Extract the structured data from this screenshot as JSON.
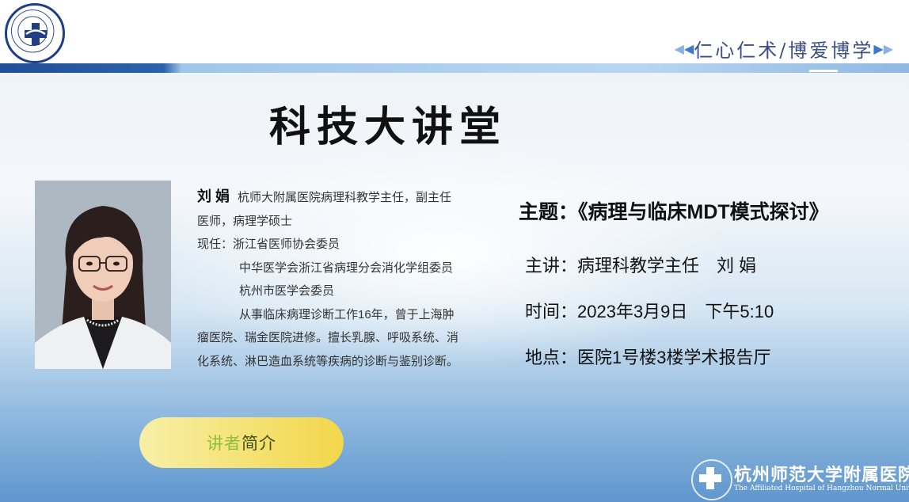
{
  "header": {
    "slogan": "仁心仁术/博爱博学"
  },
  "title": "科技大讲堂",
  "speaker": {
    "name": "刘 娟",
    "bio_lines": [
      "杭师大附属医院病理科教学主任，副主任",
      "医师，病理学硕士",
      "现任：浙江省医师协会委员",
      "中华医学会浙江省病理分会消化学组委员",
      "杭州市医学会委员",
      "从事临床病理诊断工作16年，曾于上海肿",
      "瘤医院、瑞金医院进修。擅长乳腺、呼吸系统、消",
      "化系统、淋巴造血系统等疾病的诊断与鉴别诊断。"
    ]
  },
  "event": {
    "topic": "主题：《病理与临床MDT模式探讨》",
    "lecturer": "主讲：病理科教学主任　刘 娟",
    "time": "时间：2023年3月9日　下午5:10",
    "location": "地点：医院1号楼3楼学术报告厅"
  },
  "intro_button": {
    "part1": "讲者",
    "part2": "简介"
  },
  "footer": {
    "hospital_cn": "杭州师范大学附属医院",
    "hospital_en": "The Affiliated Hospital of Hangzhou Normal University"
  },
  "colors": {
    "brand_blue": "#1f3e86",
    "button_yellow": "#f3d64a"
  }
}
